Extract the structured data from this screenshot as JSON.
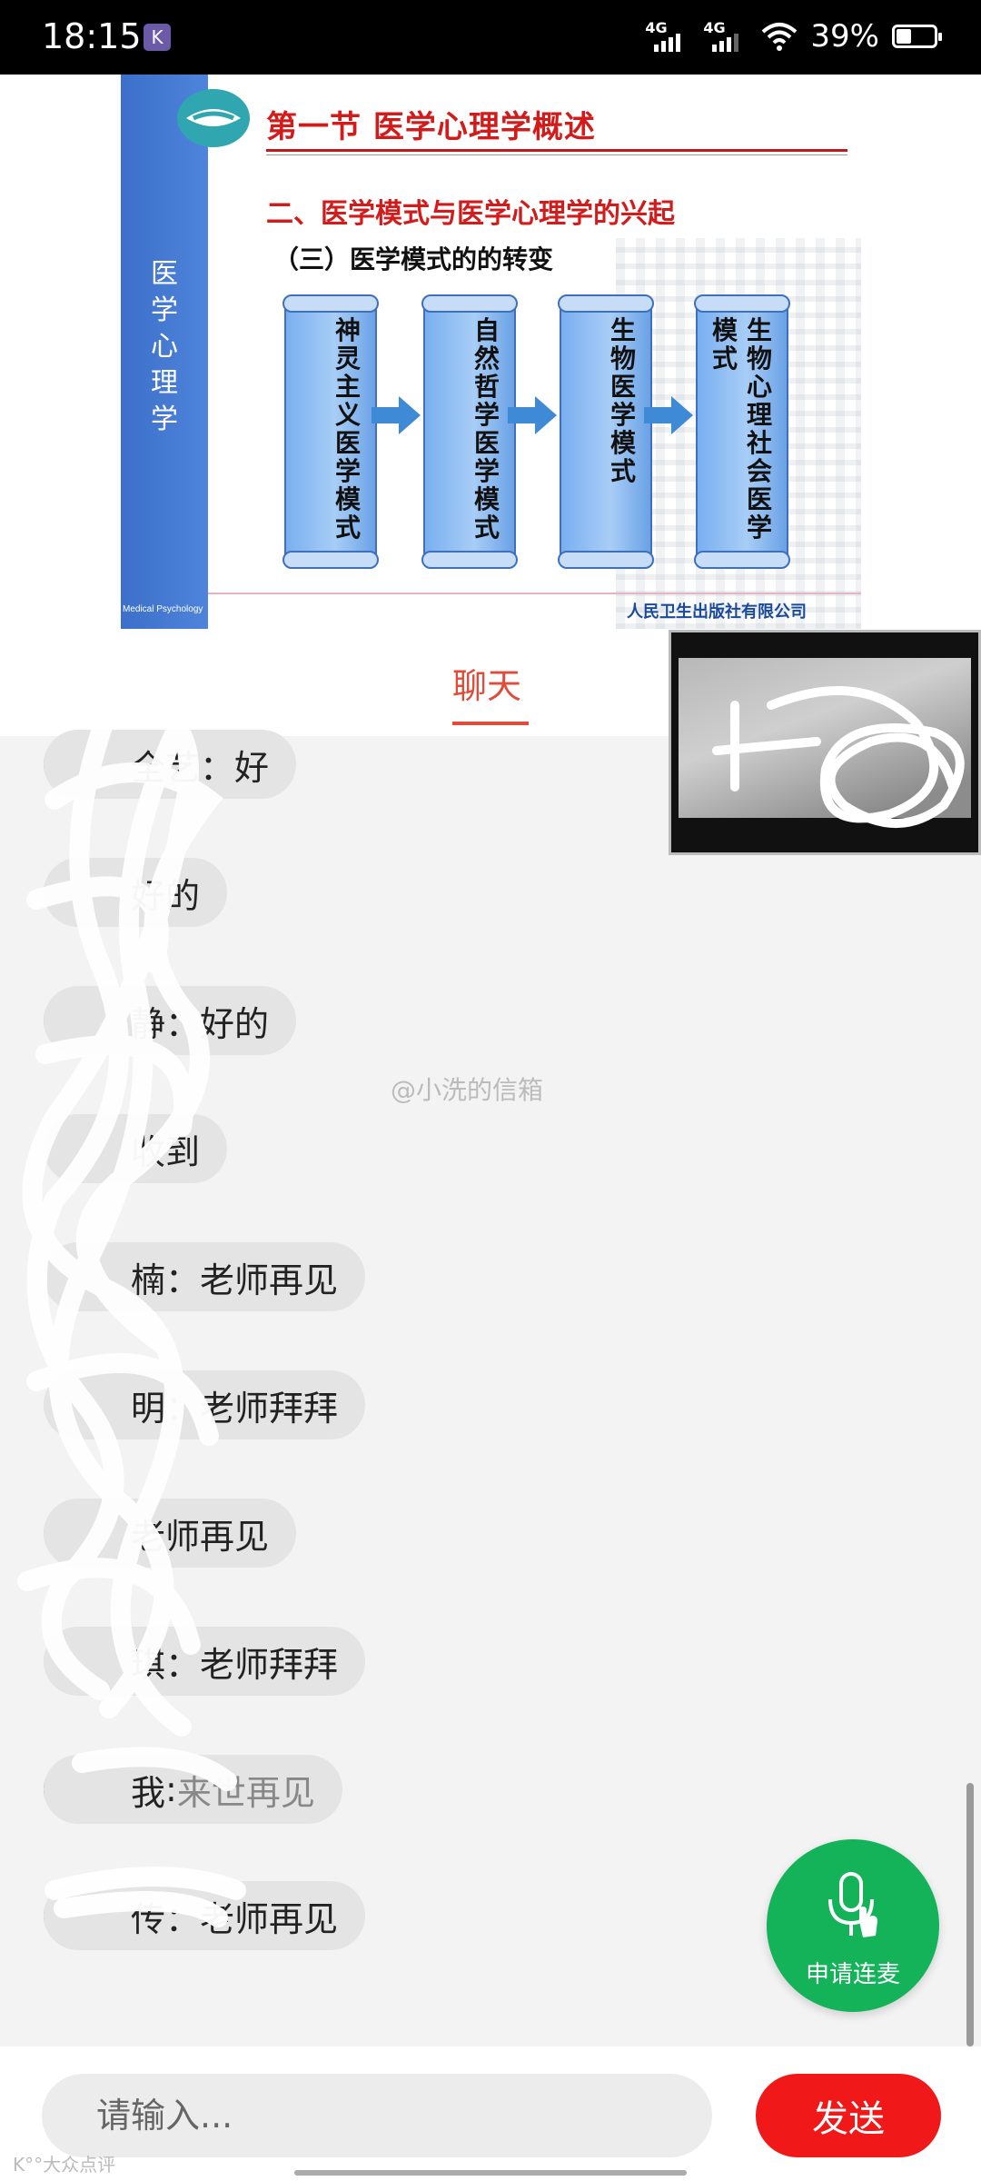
{
  "status_bar": {
    "time": "18:15",
    "app_badge": "K",
    "sim1": "4G",
    "sim2": "4G",
    "battery_text": "39%",
    "battery_level": 0.39
  },
  "slide": {
    "title": "第一节    医学心理学概述",
    "subtitle": "二、医学模式与医学心理学的兴起",
    "section": "（三）医学模式的的转变",
    "side_title": "医学心理学",
    "side_en": "Medical Psychology",
    "models": [
      {
        "col1": "神灵主义医学模式",
        "col2": ""
      },
      {
        "col1": "自然哲学医学模式",
        "col2": ""
      },
      {
        "col1": "生物医学模式",
        "col2": ""
      },
      {
        "col1": "生物心理社会医学",
        "col2": "模式"
      }
    ],
    "publisher": "人民卫生出版社有限公司"
  },
  "chat": {
    "tab_label": "聊天",
    "messages": [
      {
        "name": "全艺",
        "sep": "：",
        "text": "好",
        "avatar_color": "#2fb36a"
      },
      {
        "name": "",
        "sep": "",
        "text": "好的",
        "avatar_color": "#7a6a5a"
      },
      {
        "name": "静",
        "sep": "：",
        "text": "好的",
        "avatar_color": "#8a8a8a"
      },
      {
        "name": "",
        "sep": "",
        "text": "收到",
        "avatar_color": "#b9b2d8"
      },
      {
        "name": "楠",
        "sep": "：",
        "text": "老师再见",
        "avatar_color": "#c8d0e2"
      },
      {
        "name": "明",
        "sep": "：",
        "text": "老师拜拜",
        "avatar_color": "#c8d0e2"
      },
      {
        "name": "",
        "sep": "",
        "text": "老师再见",
        "avatar_color": "#b6b0dc"
      },
      {
        "name": "琪",
        "sep": "：",
        "text": "老师拜拜",
        "avatar_color": "#cfcfd6"
      },
      {
        "name": "我",
        "sep": " : ",
        "text": "来世再见",
        "avatar_color": "#3a2e22",
        "is_me": true
      },
      {
        "name": "传",
        "sep": "：",
        "text": "老师再见",
        "avatar_color": "#8a6a60"
      }
    ]
  },
  "watermark": "@小洗的信箱",
  "mic_button": {
    "label": "申请连麦"
  },
  "input": {
    "placeholder": "请输入..."
  },
  "send_button": {
    "label": "发送"
  },
  "footer_mark": "K°°大众点评"
}
